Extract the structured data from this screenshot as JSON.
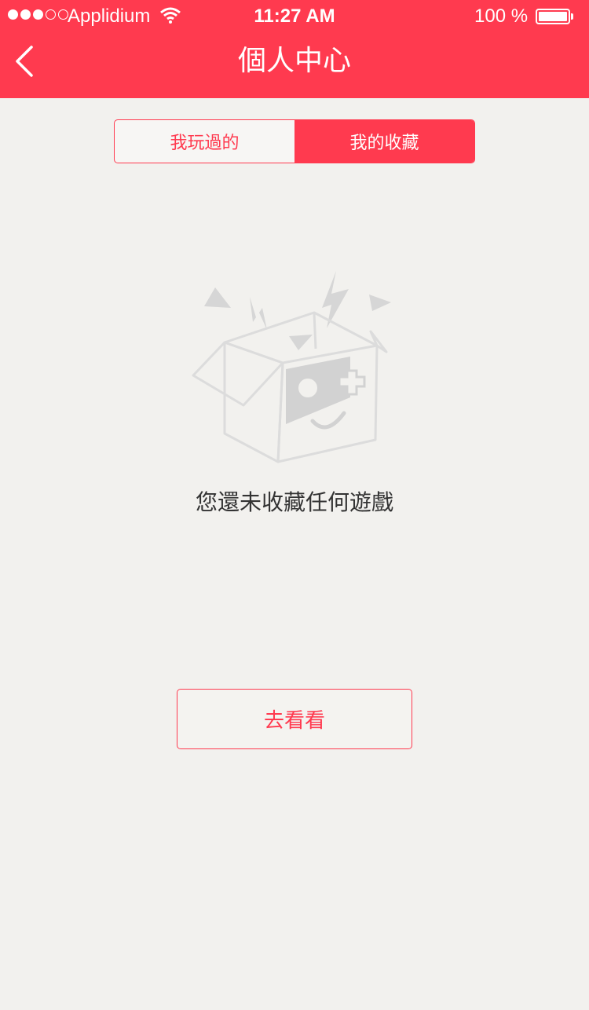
{
  "status_bar": {
    "carrier": "Applidium",
    "time": "11:27 AM",
    "battery": "100 %"
  },
  "nav": {
    "title": "個人中心",
    "back_icon": "chevron-left-icon"
  },
  "tabs": [
    {
      "label": "我玩過的",
      "active": false
    },
    {
      "label": "我的收藏",
      "active": true
    }
  ],
  "empty_state": {
    "illustration": "open-box-game-controller-icon",
    "message": "您還未收藏任何遊戲"
  },
  "action_button": {
    "label": "去看看"
  },
  "colors": {
    "accent": "#ff3a4f",
    "background": "#f2f1ee"
  }
}
